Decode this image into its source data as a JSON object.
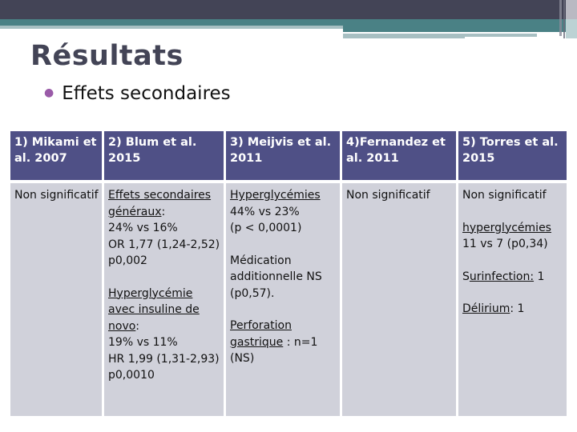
{
  "slide": {
    "title": "Résultats",
    "bullet": "Effets secondaires"
  },
  "table": {
    "headers": [
      "1) Mikami et al. 2007",
      "2) Blum et al. 2015",
      "3) Meijvis et al. 2011",
      "4)Fernandez et al. 2011",
      "5) Torres et al. 2015"
    ],
    "col1": {
      "text": "Non significatif"
    },
    "col2": {
      "block1_label": "Effets secondaires généraux",
      "block1_colon": ":",
      "block1_line1": "24% vs 16%",
      "block1_line2": "OR 1,77 (1,24-2,52) p0,002",
      "block2_label": "Hyperglycémie avec insuline de novo",
      "block2_colon": ":",
      "block2_line1": "19% vs 11%",
      "block2_line2": "HR 1,99 (1,31-2,93) p0,0010"
    },
    "col3": {
      "block1_label": "Hyperglycémies",
      "block1_line1": "44% vs 23%",
      "block1_line2": "(p < 0,0001)",
      "block2_line1": "Médication additionnelle NS",
      "block2_line2": "(p0,57).",
      "block3_label": "Perforation gastrique",
      "block3_rest": " : n=1",
      "block3_line2": "(NS)"
    },
    "col4": {
      "text": "Non significatif"
    },
    "col5": {
      "line1": "Non significatif",
      "block2_label": "hyperglycémies",
      "block2_line1": "11 vs 7 (p0,34)",
      "block3_prefix": "S",
      "block3_label": "urinfection:",
      "block3_rest": " 1",
      "block4_label": "Délirium",
      "block4_rest": ": 1"
    }
  },
  "colors": {
    "header_bg": "#4f5086",
    "body_bg": "#d0d1da",
    "title_color": "#434456",
    "bullet_color": "#9a5ba8",
    "top_band": "#434456",
    "teal_band": "#4a8185"
  }
}
